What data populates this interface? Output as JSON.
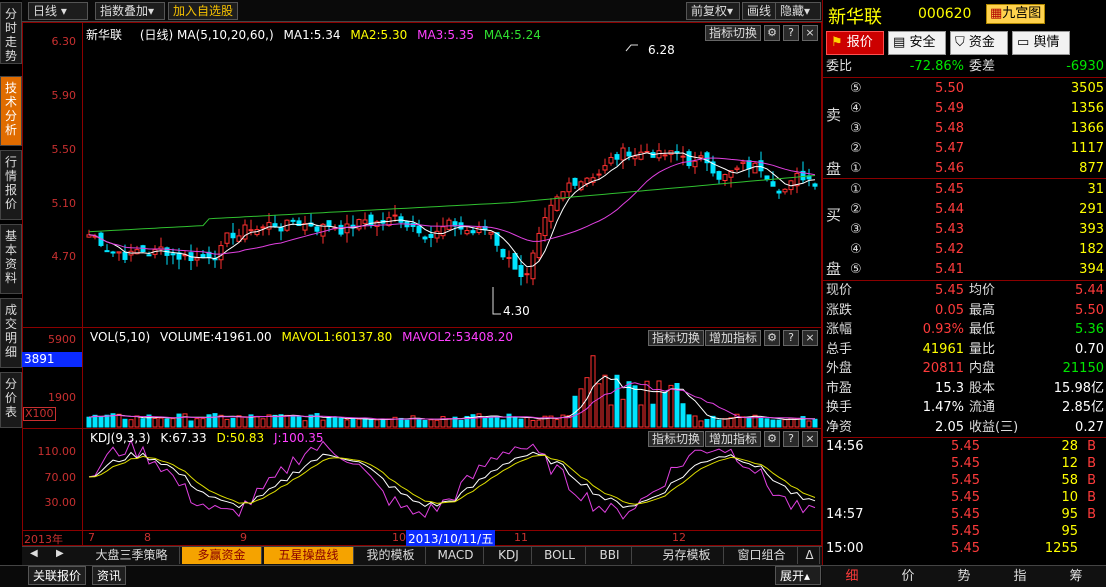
{
  "toolbar": {
    "period": "日线",
    "overlay": "指数叠加",
    "add_fav": "加入自选股",
    "restore": "前复权",
    "draw": "画线",
    "hide": "隐藏"
  },
  "side_tabs": [
    "分时走势",
    "技术分析",
    "行情报价",
    "基本资料",
    "成交明细",
    "分价表"
  ],
  "main": {
    "title": "新华联",
    "period": "(日线)",
    "ma_params": "MA(5,10,20,60,)",
    "ma1": "MA1:5.34",
    "ma2": "MA2:5.30",
    "ma3": "MA3:5.35",
    "ma4": "MA4:5.24",
    "high_label": "6.28",
    "low_label": "4.30",
    "y_ticks": [
      "6.30",
      "5.90",
      "5.50",
      "5.10",
      "4.70"
    ],
    "btn_switch": "指标切换",
    "btn_q": "?",
    "btn_x": "×"
  },
  "vol": {
    "label": "VOL(5,10)",
    "volume": "VOLUME:41961.00",
    "mavol1": "MAVOL1:60137.80",
    "mavol2": "MAVOL2:53408.20",
    "y_ticks": [
      "5900",
      "1900"
    ],
    "highlight": "3891",
    "unit": "X100",
    "btn_switch": "指标切换",
    "btn_add": "增加指标"
  },
  "kdj": {
    "label": "KDJ(9,3,3)",
    "k": "K:67.33",
    "d": "D:50.83",
    "j": "J:100.35",
    "y_ticks": [
      "110.00",
      "70.00",
      "30.00"
    ],
    "btn_switch": "指标切换",
    "btn_add": "增加指标"
  },
  "xaxis": {
    "year": "2013年",
    "months": [
      "7",
      "8",
      "9",
      "10",
      "11",
      "12"
    ],
    "cursor_date": "2013/10/11/五"
  },
  "bottom_tabs": [
    "大盘三季策略",
    "多赢资金",
    "五星操盘线",
    "我的模板",
    "MACD",
    "KDJ",
    "BOLL",
    "BBI",
    "另存模板",
    "窗口组合",
    "Δ"
  ],
  "footer": {
    "tab1": "关联报价",
    "tab2": "资讯",
    "expand": "展开"
  },
  "right": {
    "name": "新华联",
    "code": "000620",
    "palace": "九宫图",
    "buttons": [
      "报价",
      "安全",
      "资金",
      "舆情"
    ],
    "weibi_label": "委比",
    "weibi": "-72.86%",
    "weicha_label": "委差",
    "weicha": "-6930",
    "sell": [
      {
        "n": "⑤",
        "p": "5.50",
        "v": "3505"
      },
      {
        "n": "④",
        "p": "5.49",
        "v": "1356"
      },
      {
        "n": "③",
        "p": "5.48",
        "v": "1366"
      },
      {
        "n": "②",
        "p": "5.47",
        "v": "1117"
      },
      {
        "n": "①",
        "p": "5.46",
        "v": "877"
      }
    ],
    "buy": [
      {
        "n": "①",
        "p": "5.45",
        "v": "31"
      },
      {
        "n": "②",
        "p": "5.44",
        "v": "291"
      },
      {
        "n": "③",
        "p": "5.43",
        "v": "393"
      },
      {
        "n": "④",
        "p": "5.42",
        "v": "182"
      },
      {
        "n": "⑤",
        "p": "5.41",
        "v": "394"
      }
    ],
    "sell_chars": [
      "卖",
      "盘"
    ],
    "buy_chars": [
      "买",
      "盘"
    ],
    "stats": [
      {
        "k1": "现价",
        "v1": "5.45",
        "k2": "均价",
        "v2": "5.44"
      },
      {
        "k1": "涨跌",
        "v1": "0.05",
        "k2": "最高",
        "v2": "5.50"
      },
      {
        "k1": "涨幅",
        "v1": "0.93%",
        "k2": "最低",
        "v2": "5.36"
      },
      {
        "k1": "总手",
        "v1": "41961",
        "k2": "量比",
        "v2": "0.70"
      },
      {
        "k1": "外盘",
        "v1": "20811",
        "k2": "内盘",
        "v2": "21150"
      },
      {
        "k1": "市盈",
        "v1": "15.3",
        "k2": "股本",
        "v2": "15.98亿"
      },
      {
        "k1": "换手",
        "v1": "1.47%",
        "k2": "流通",
        "v2": "2.85亿"
      },
      {
        "k1": "净资",
        "v1": "2.05",
        "k2": "收益(三)",
        "v2": "0.27"
      }
    ],
    "ticks": [
      {
        "t": "14:56",
        "p": "5.45",
        "v": "28",
        "s": "B"
      },
      {
        "t": "",
        "p": "5.45",
        "v": "12",
        "s": "B"
      },
      {
        "t": "",
        "p": "5.45",
        "v": "58",
        "s": "B"
      },
      {
        "t": "",
        "p": "5.45",
        "v": "10",
        "s": "B"
      },
      {
        "t": "14:57",
        "p": "5.45",
        "v": "95",
        "s": "B"
      },
      {
        "t": "",
        "p": "5.45",
        "v": "95",
        "s": ""
      },
      {
        "t": "15:00",
        "p": "5.45",
        "v": "1255",
        "s": ""
      }
    ],
    "nav": [
      "细",
      "价",
      "势",
      "指",
      "筹"
    ]
  }
}
